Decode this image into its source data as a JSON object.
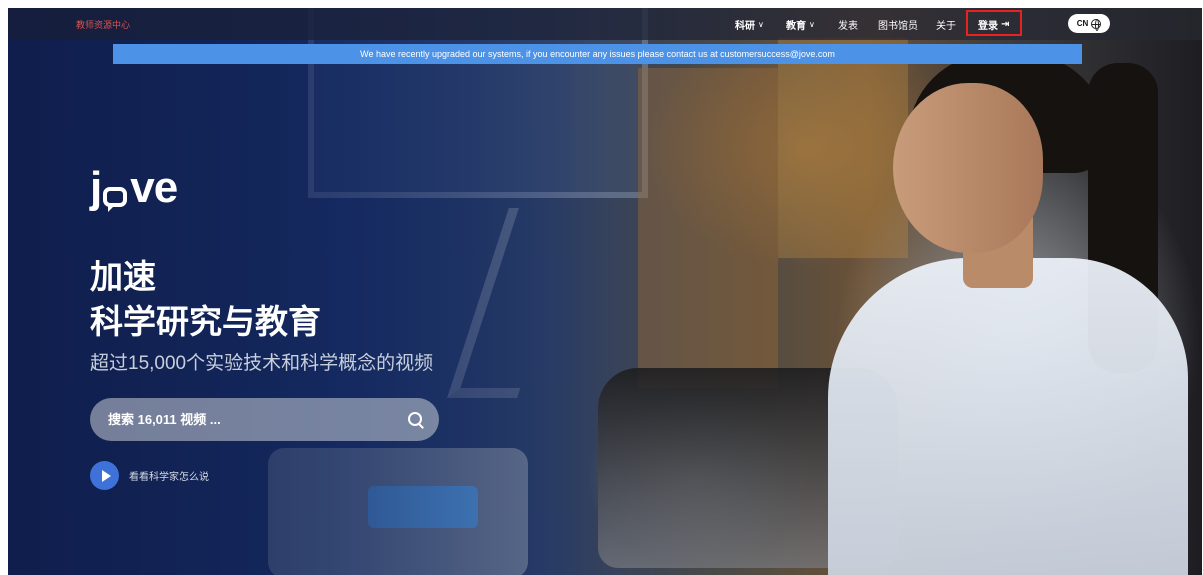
{
  "topbar": {
    "teacher_link": "教师资源中心",
    "nav": [
      {
        "label": "科研",
        "has_dropdown": true
      },
      {
        "label": "教育",
        "has_dropdown": true
      },
      {
        "label": "发表",
        "has_dropdown": false
      },
      {
        "label": "图书馆员",
        "has_dropdown": false
      },
      {
        "label": "关于",
        "has_dropdown": false
      }
    ],
    "login_label": "登录",
    "login_icon": "login-icon",
    "language_label": "CN",
    "language_icon": "globe-icon"
  },
  "banner": {
    "text": "We have recently upgraded our systems, if you encounter any issues please contact us at  customersuccess@jove.com"
  },
  "hero": {
    "logo_text_left": "j",
    "logo_text_right": "ve",
    "headline_line1": "加速",
    "headline_line2": "科学研究与教育",
    "subheadline": "超过15,000个实验技术和科学概念的视频",
    "search_placeholder": "搜索 16,011 视频 ...",
    "watch_label": "看看科学家怎么说"
  },
  "colors": {
    "banner_bg": "#4c93e8",
    "teacher_link": "#d9534f",
    "login_highlight": "#e8231f",
    "play_button": "#3f72d8"
  }
}
